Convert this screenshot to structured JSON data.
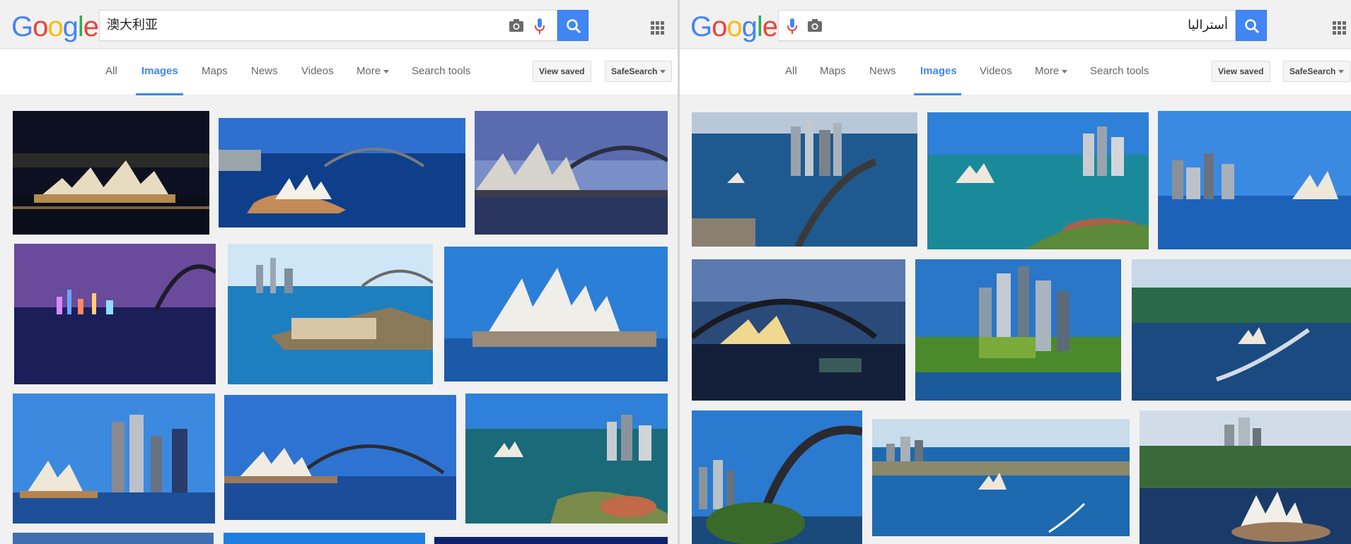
{
  "left": {
    "logo": "Google",
    "query": "澳大利亚",
    "tabs": [
      "All",
      "Images",
      "Maps",
      "News",
      "Videos",
      "More",
      "Search tools"
    ],
    "active_tab": "Images",
    "view_saved": "View saved",
    "safesearch": "SafeSearch"
  },
  "right": {
    "logo": "Google",
    "query": "أستراليا",
    "tabs": [
      "All",
      "Maps",
      "News",
      "Images",
      "Videos",
      "More",
      "Search tools"
    ],
    "active_tab": "Images",
    "view_saved": "View saved",
    "safesearch": "SafeSearch"
  },
  "colors": {
    "google_blue": "#4285f4",
    "active_tab": "#4285f4",
    "page_bg": "#f1f1f1"
  },
  "icons": [
    "camera-icon",
    "microphone-icon",
    "search-icon",
    "apps-grid-icon",
    "dropdown-caret-icon"
  ]
}
